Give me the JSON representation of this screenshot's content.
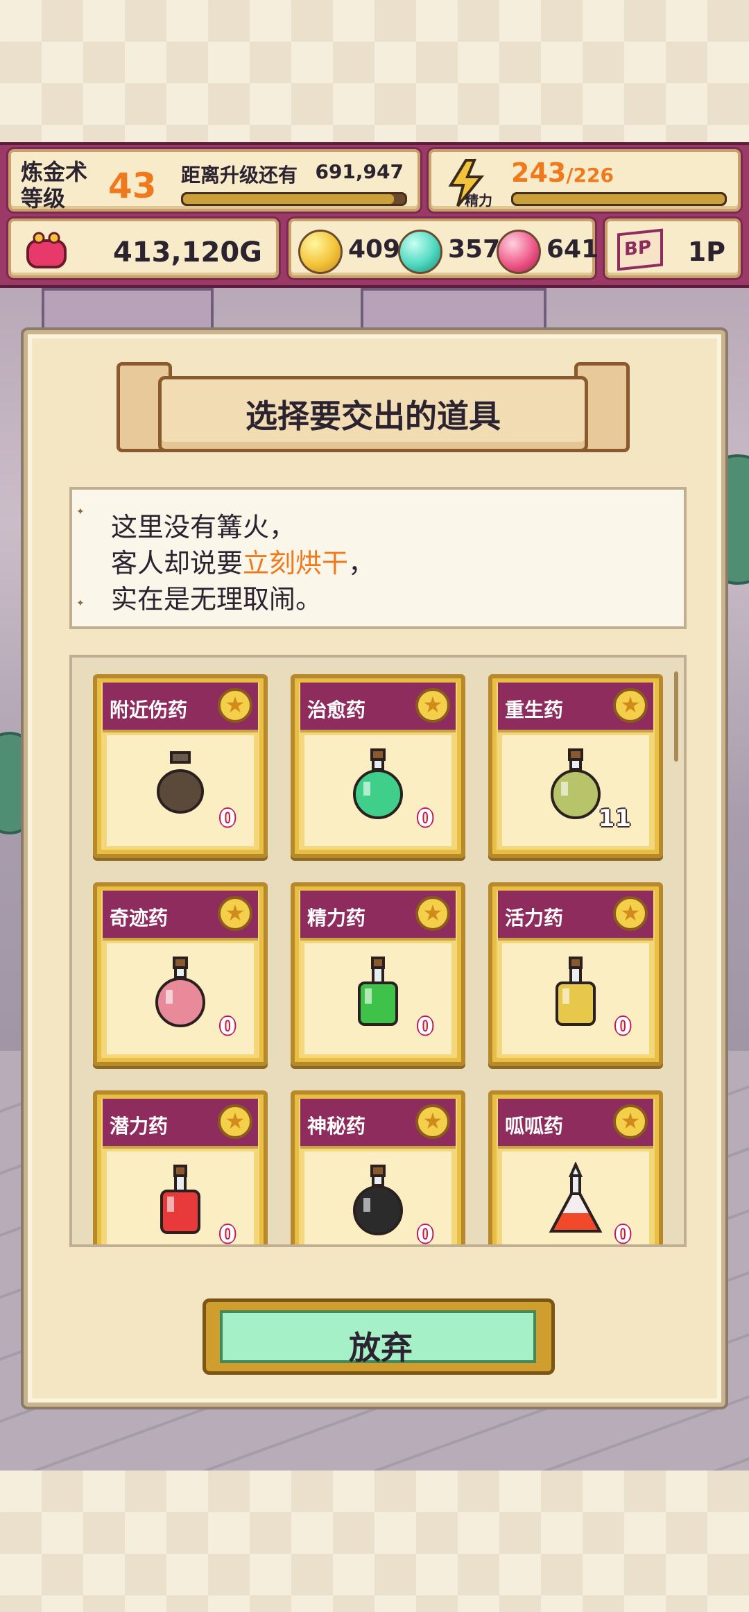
{
  "status": {
    "level_label": "炼金术\n等级",
    "level_value": "43",
    "xp_label": "距离升级还有",
    "xp_value": "691,947",
    "xp_progress": 0.95,
    "energy_label": "精力",
    "energy_current": "243",
    "energy_max": "/226",
    "energy_progress": 1.0,
    "gold": "413,120G",
    "orb_yellow": "409",
    "orb_cyan": "357",
    "orb_pink": "641",
    "bp_label": "BP",
    "bp_value": "1P"
  },
  "dialog": {
    "title": "选择要交出的道具",
    "message_line1": "这里没有篝火，",
    "message_line2_a": "客人却说要",
    "message_line2_highlight": "立刻烘干",
    "message_line2_b": "，",
    "message_line3": "实在是无理取闹。",
    "items": [
      {
        "name": "附近伤药",
        "qty": "0",
        "color": "#5b4a3a",
        "shape": "pot"
      },
      {
        "name": "治愈药",
        "qty": "0",
        "color": "#3fcf8a",
        "shape": "round"
      },
      {
        "name": "重生药",
        "qty": "11",
        "color": "#b8c46a",
        "shape": "round"
      },
      {
        "name": "奇迹药",
        "qty": "0",
        "color": "#e88a9a",
        "shape": "round"
      },
      {
        "name": "精力药",
        "qty": "0",
        "color": "#3fc24a",
        "shape": "square"
      },
      {
        "name": "活力药",
        "qty": "0",
        "color": "#e8c84a",
        "shape": "square"
      },
      {
        "name": "潜力药",
        "qty": "0",
        "color": "#e83a3a",
        "shape": "square"
      },
      {
        "name": "神秘药",
        "qty": "0",
        "color": "#2b2b2b",
        "shape": "round"
      },
      {
        "name": "呱呱药",
        "qty": "0",
        "color": "#f04a2a",
        "shape": "flask"
      }
    ],
    "give_up_label": "放弃"
  }
}
